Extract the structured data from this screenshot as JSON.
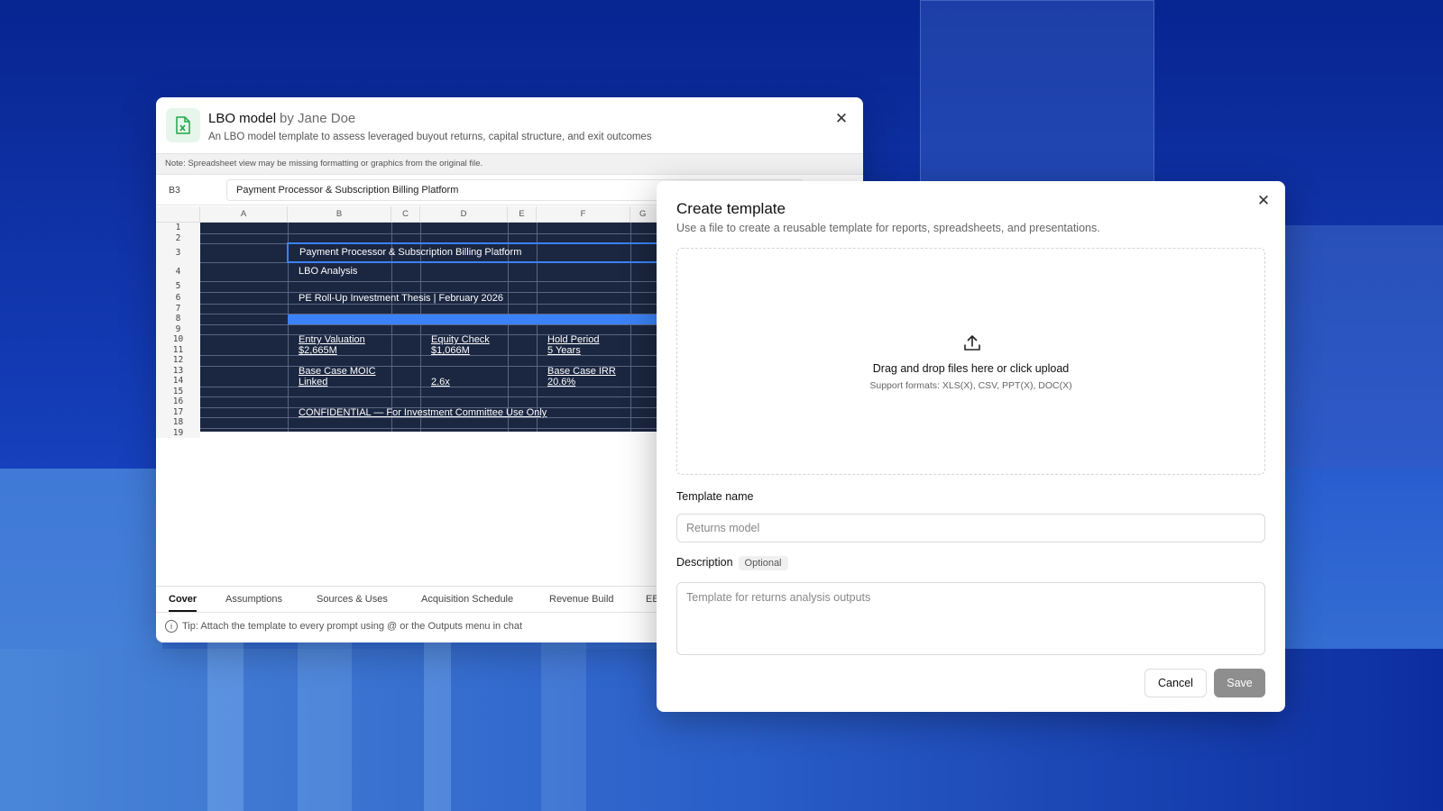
{
  "preview": {
    "title": "LBO model",
    "author": "by Jane Doe",
    "subtitle": "An LBO model template to assess leveraged buyout returns, capital structure, and exit outcomes",
    "note": "Note: Spreadsheet view may be missing formatting or graphics from the original file.",
    "cell_ref": "B3",
    "formula_value": "Payment Processor & Subscription Billing Platform",
    "columns": [
      "A",
      "B",
      "C",
      "D",
      "E",
      "F",
      "G"
    ],
    "rows": [
      "1",
      "2",
      "3",
      "4",
      "5",
      "6",
      "7",
      "8",
      "9",
      "10",
      "11",
      "12",
      "13",
      "14",
      "15",
      "16",
      "17",
      "18",
      "19"
    ],
    "cells": {
      "b3": "Payment Processor & Subscription Billing Platform",
      "b4": "LBO Analysis",
      "b6": "PE Roll-Up Investment Thesis | February 2026",
      "b10": "Entry Valuation",
      "b11": "$2,665M",
      "d10": "Equity Check",
      "d11": "$1,066M",
      "f10": "Hold Period",
      "f11": "5 Years",
      "b13": "Base Case MOIC",
      "b14": "Linked",
      "d14": "2.6x",
      "f13": "Base Case IRR",
      "f14": "20.6%",
      "b17": "CONFIDENTIAL — For Investment Committee Use Only"
    },
    "tabs": [
      "Cover",
      "Assumptions",
      "Sources & Uses",
      "Acquisition Schedule",
      "Revenue Build",
      "EB"
    ],
    "active_tab": "Cover",
    "tip": "Tip:  Attach the template to every prompt using @ or the Outputs menu in chat"
  },
  "modal": {
    "title": "Create template",
    "subtitle": "Use a file to create a reusable template for reports, spreadsheets, and presentations.",
    "dropzone_main": "Drag and drop files here or click upload",
    "dropzone_formats": "Support formats: XLS(X), CSV, PPT(X), DOC(X)",
    "name_label": "Template name",
    "name_placeholder": "Returns model",
    "desc_label": "Description",
    "desc_badge": "Optional",
    "desc_placeholder": "Template for returns analysis outputs",
    "cancel": "Cancel",
    "save": "Save"
  },
  "colors": {
    "sheet_bg": "#1b2640",
    "selection": "#3b82f6",
    "save_disabled": "#8e8e8e",
    "excel_green": "#22a447"
  }
}
